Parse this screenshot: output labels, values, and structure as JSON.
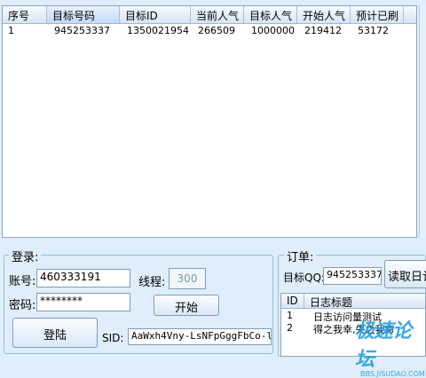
{
  "main_table": {
    "columns": [
      "序号",
      "目标号码",
      "目标ID",
      "当前人气",
      "目标人气",
      "开始人气",
      "预计已刷"
    ],
    "rows": [
      [
        "1",
        "945253337",
        "1350021954",
        "266509",
        "1000000",
        "219412",
        "53172"
      ]
    ]
  },
  "login": {
    "legend": "登录:",
    "account_label": "账号:",
    "account_value": "460333191",
    "password_label": "密码:",
    "password_value": "********",
    "threads_label": "线程:",
    "threads_value": "300",
    "start_button": "开始",
    "login_button": "登陆",
    "sid_label": "SID:",
    "sid_value": "AaWxh4Vny-LsNFpGggFbCo-l"
  },
  "order": {
    "legend": "订单:",
    "target_qq_label": "目标QQ:",
    "target_qq_value": "945253337",
    "read_button": "读取日记"
  },
  "diary_table": {
    "columns": [
      "ID",
      "日志标题"
    ],
    "rows": [
      [
        "1",
        "日志访问量测试"
      ],
      [
        "2",
        "得之我幸,失之我命"
      ]
    ]
  },
  "watermark": {
    "text": "极速论坛",
    "sub": "BBS.JISUDAO.COM"
  }
}
